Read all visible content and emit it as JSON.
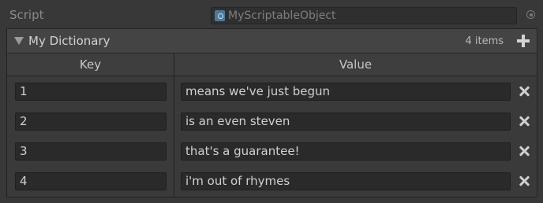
{
  "script": {
    "label": "Script",
    "value": "MyScriptableObject"
  },
  "dictionary": {
    "title": "My Dictionary",
    "count": "4 items",
    "columns": {
      "key": "Key",
      "value": "Value"
    },
    "rows": [
      {
        "key": "1",
        "value": "means we've just begun"
      },
      {
        "key": "2",
        "value": "is an even steven"
      },
      {
        "key": "3",
        "value": "that's a guarantee!"
      },
      {
        "key": "4",
        "value": "i'm out of rhymes"
      }
    ]
  }
}
